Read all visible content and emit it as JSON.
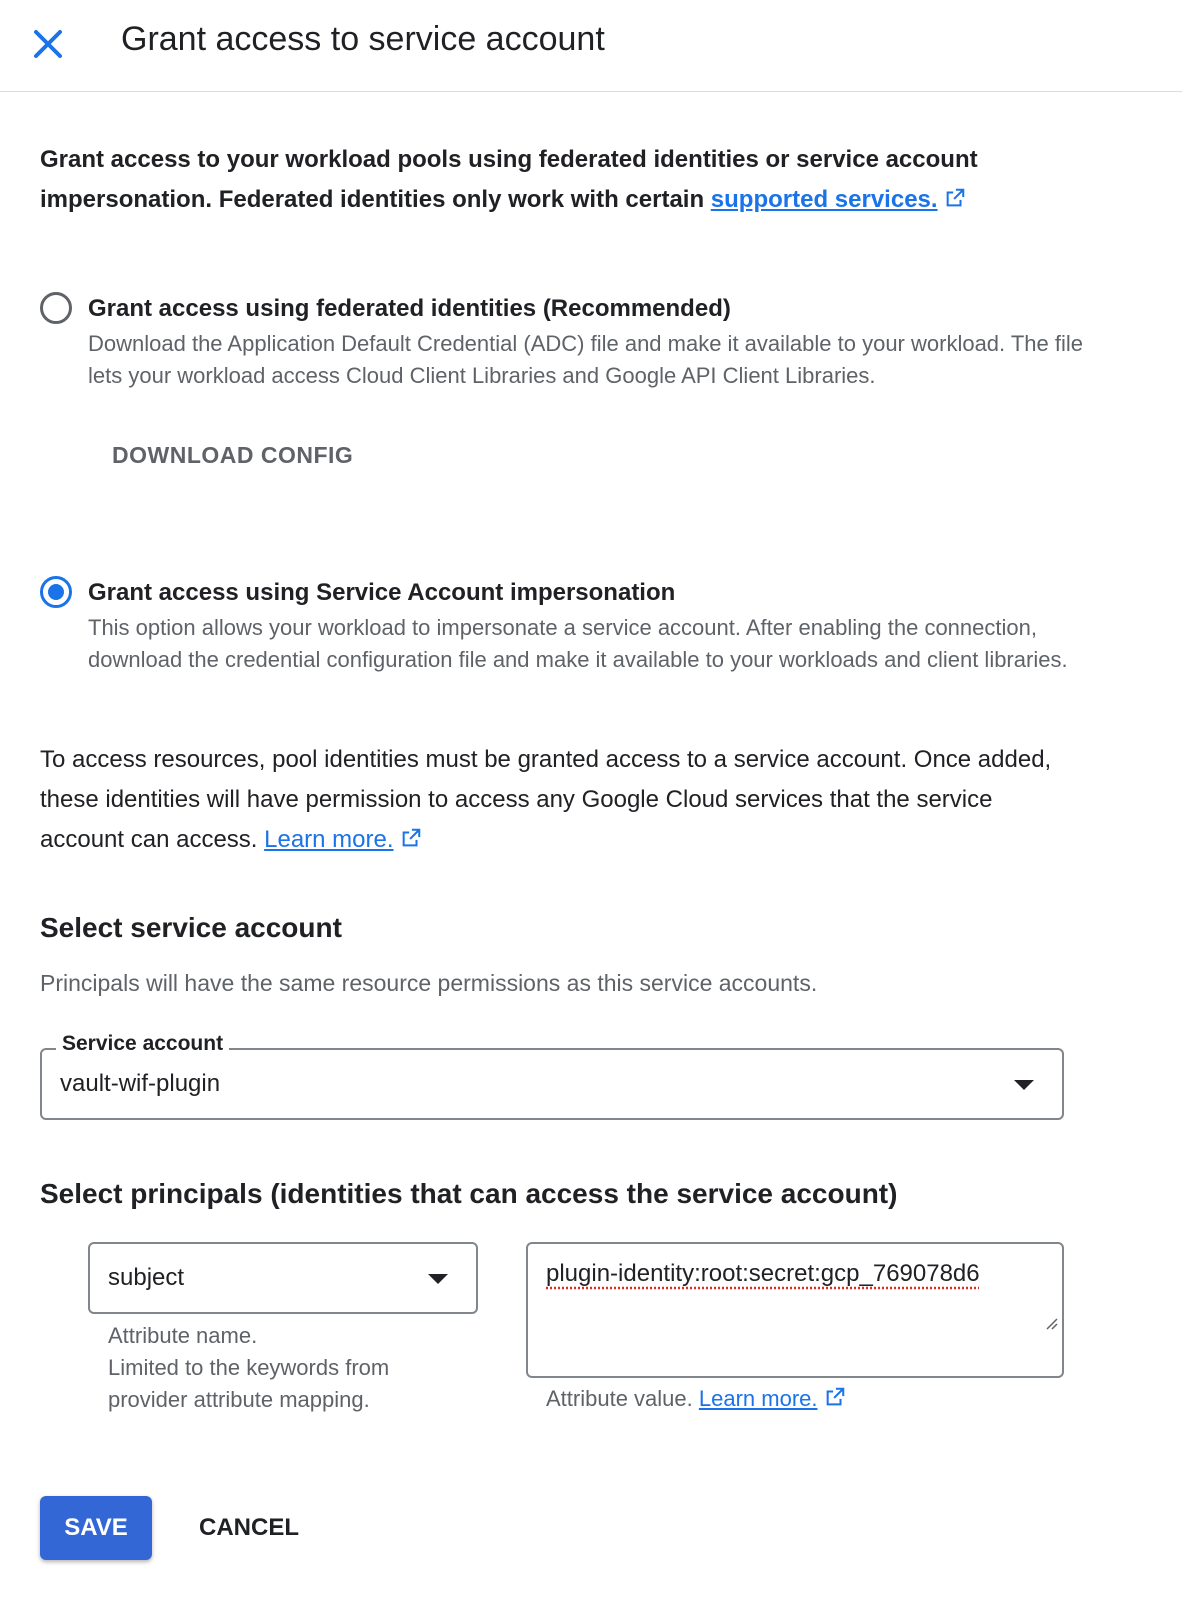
{
  "header": {
    "title": "Grant access to service account"
  },
  "intro": {
    "text": "Grant access to your workload pools using federated identities or service account impersonation. Federated identities only work with certain ",
    "link_label": "supported services."
  },
  "options": [
    {
      "title": "Grant access using federated identities (Recommended)",
      "description": "Download the Application Default Credential (ADC) file and make it available to your workload. The file lets your workload access Cloud Client Libraries and Google API Client Libraries.",
      "selected": false
    },
    {
      "title": "Grant access using Service Account impersonation",
      "description": "This option allows your workload to impersonate a service account. After enabling the connection, download the credential configuration file and make it available to your workloads and client libraries.",
      "selected": true
    }
  ],
  "download_button": "DOWNLOAD CONFIG",
  "access_paragraph": {
    "text": "To access resources, pool identities must be granted access to a service account. Once added, these identities will have permission to access any Google Cloud services that the service account can access. ",
    "link_label": "Learn more."
  },
  "service_account_section": {
    "title": "Select service account",
    "subtitle": "Principals will have the same resource permissions as this service accounts.",
    "field_label": "Service account",
    "field_value": "vault-wif-plugin"
  },
  "principals_section": {
    "title": "Select principals (identities that can access the service account)",
    "attribute_name_value": "subject",
    "attribute_name_helper_1": "Attribute name.",
    "attribute_name_helper_2": "Limited to the keywords from",
    "attribute_name_helper_3": "provider attribute mapping.",
    "attribute_value": "plugin-identity:root:secret:gcp_769078d6",
    "attribute_value_helper": "Attribute value. ",
    "attribute_value_link": "Learn more."
  },
  "footer": {
    "save_label": "SAVE",
    "cancel_label": "CANCEL"
  },
  "colors": {
    "accent": "#1a73e8",
    "save_button": "#3367d6",
    "secondary_text": "#5f6368"
  }
}
